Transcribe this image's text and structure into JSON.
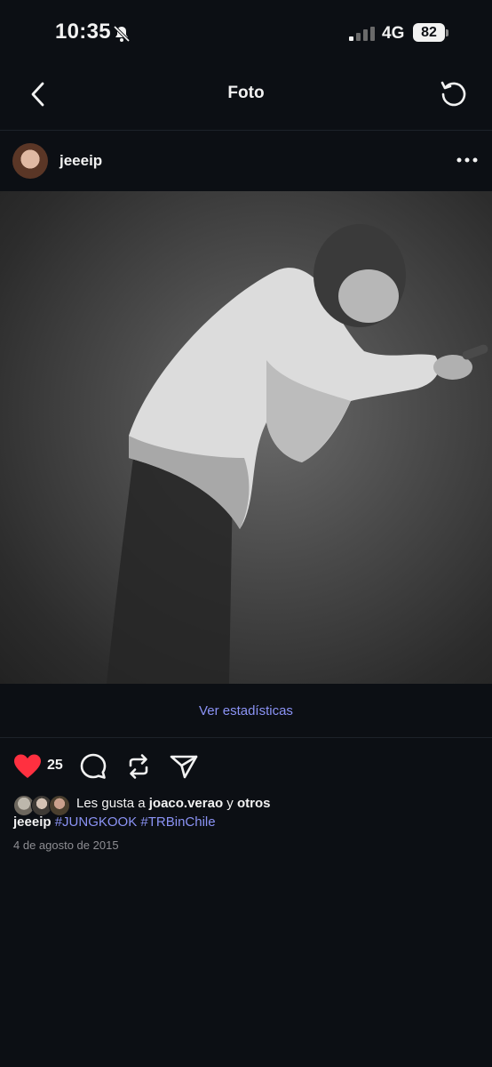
{
  "status": {
    "time": "10:35",
    "network": "4G",
    "battery": "82"
  },
  "nav": {
    "title": "Foto"
  },
  "post": {
    "username": "jeeeip",
    "stats_label": "Ver estadísticas",
    "like_count": "25",
    "likes_prefix": "Les gusta a",
    "liked_by": "joaco.verao",
    "likes_joiner": "y",
    "likes_others": "otros",
    "caption_user": "jeeeip",
    "hashtags": [
      "#JUNGKOOK",
      "#TRBinChile"
    ],
    "date": "4 de agosto de 2015"
  },
  "colors": {
    "background": "#0c0f14",
    "link": "#8b93f5",
    "heart": "#ff3040"
  },
  "icons": [
    "bell-off-icon",
    "signal-icon",
    "chevron-left-icon",
    "refresh-icon",
    "more-icon",
    "heart-icon",
    "comment-icon",
    "repost-icon",
    "send-icon"
  ]
}
